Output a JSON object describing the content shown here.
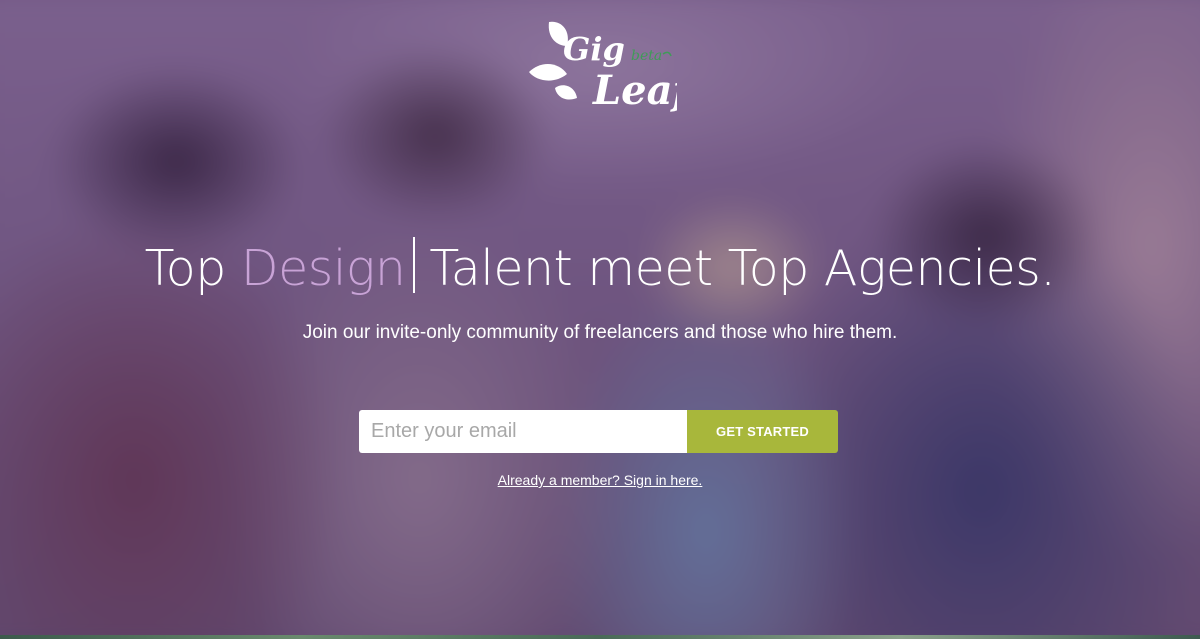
{
  "logo": {
    "word1": "Gig",
    "word2": "Leaf",
    "badge": "beta"
  },
  "headline": {
    "part1": "Top ",
    "accent": "Design",
    "part2": "Talent meet Top Agencies."
  },
  "subheadline": "Join our invite-only community of freelancers and those who hire them.",
  "signup": {
    "email_placeholder": "Enter your email",
    "button_label": "GET STARTED"
  },
  "signin_link": "Already a member? Sign in here.",
  "colors": {
    "accent_purple": "#c8a3d6",
    "button_green": "#a8b73b",
    "logo_green": "#3f9b58",
    "overlay_purple": "#502d64"
  }
}
